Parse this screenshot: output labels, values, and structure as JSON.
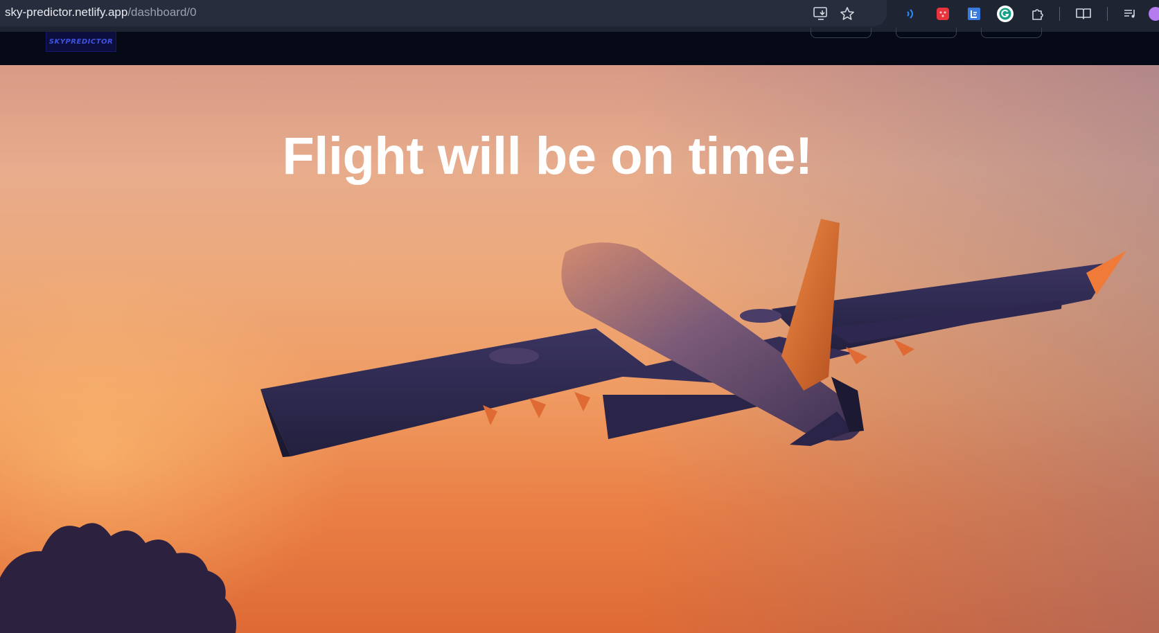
{
  "browser": {
    "url_host": "sky-predictor.netlify.app",
    "url_path": "/dashboard/0",
    "toolbar_icons": [
      "install-app-icon",
      "bookmark-star-icon",
      "read-aloud-icon",
      "extension-red-icon",
      "extension-blue-icon",
      "grammarly-icon",
      "extensions-puzzle-icon",
      "reading-mode-icon",
      "media-playlist-icon",
      "profile-avatar-icon"
    ]
  },
  "app": {
    "logo_text": "SKYPREDICTOR"
  },
  "hero": {
    "headline": "Flight will be on time!"
  },
  "colors": {
    "browser_bg": "#1f2433",
    "nav_bg": "#060a17",
    "logo_text": "#3f52e0",
    "headline": "#ffffff",
    "sky_top": "#d79a86",
    "sky_bottom": "#de6a35"
  }
}
